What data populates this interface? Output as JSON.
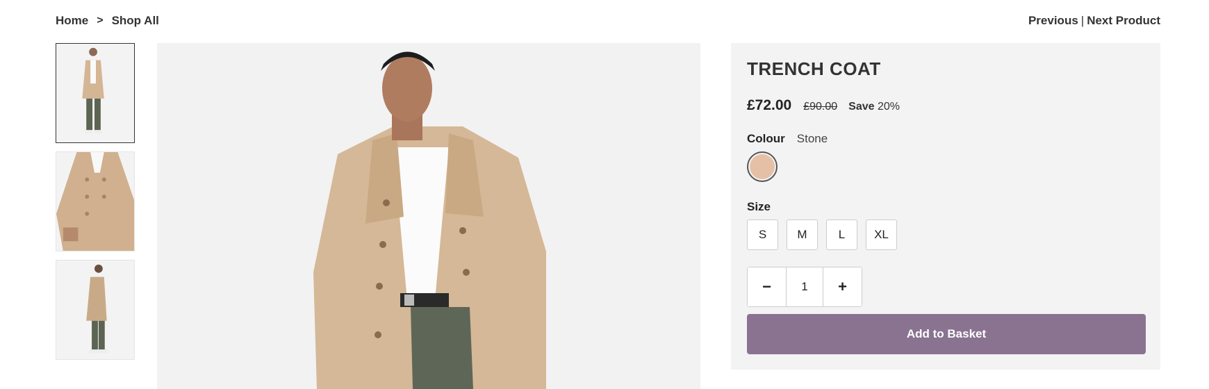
{
  "breadcrumb": {
    "home": "Home",
    "separator": ">",
    "current": "Shop All"
  },
  "product_nav": {
    "previous": "Previous",
    "divider": "|",
    "next": "Next Product"
  },
  "product": {
    "title": "TRENCH COAT",
    "price": "£72.00",
    "was_price": "£90.00",
    "save_label": "Save",
    "save_value": "20%",
    "colour_label": "Colour",
    "colour_value": "Stone",
    "swatch_color": "#e6c0a6",
    "size_label": "Size",
    "sizes": [
      "S",
      "M",
      "L",
      "XL"
    ],
    "quantity": "1",
    "qty_minus": "−",
    "qty_plus": "+",
    "add_to_basket": "Add to Basket",
    "button_color": "#8a7391"
  },
  "icons": {
    "thumbnails": [
      "product-thumbnail-front",
      "product-thumbnail-detail",
      "product-thumbnail-side"
    ],
    "main_image": "product-main-image"
  }
}
